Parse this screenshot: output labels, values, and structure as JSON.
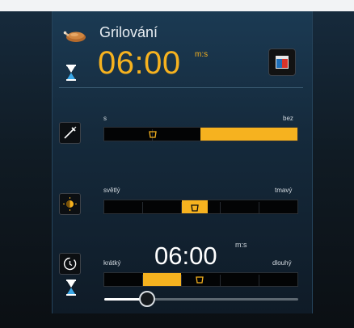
{
  "program": {
    "icon": "grill-chicken-icon",
    "title": "Grilování",
    "time": "06:00",
    "time_unit": "m:s"
  },
  "menu_button": {
    "icon": "menu-icon",
    "colors": [
      "#1f6fb8",
      "#d9342b",
      "#e8e8e8"
    ]
  },
  "settings": {
    "grill_level": {
      "icon": "grill-level-icon",
      "label_left": "s",
      "label_right": "bez",
      "value_fraction": 0.5
    },
    "browning": {
      "icon": "browning-icon",
      "label_left": "světlý",
      "label_right": "tmavý",
      "value_fraction": 0.5
    },
    "timer": {
      "icon": "timer-icon",
      "label_left": "krátký",
      "label_right": "dlouhý",
      "time": "06:00",
      "time_unit": "m:s",
      "value_fraction": 0.4,
      "slider_fraction": 0.22
    }
  },
  "colors": {
    "accent": "#f6b21f",
    "hourglass": "#3ba7e6"
  }
}
